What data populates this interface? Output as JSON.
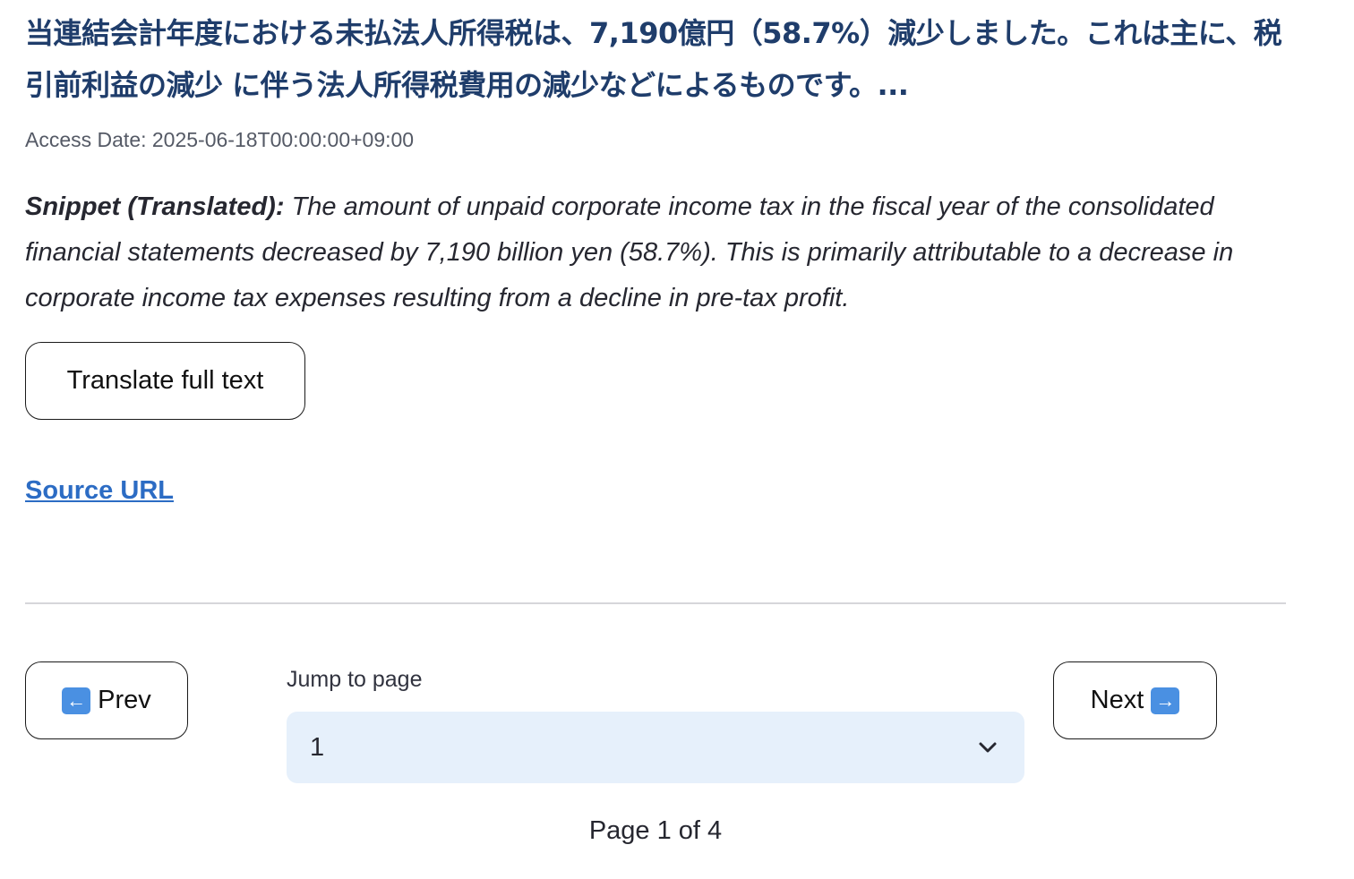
{
  "result": {
    "title": "当連結会計年度における未払法人所得税は、7,190億円（58.7%）減少しました。これは主に、税引前利益の減少 に伴う法人所得税費用の減少などによるものです。...",
    "access_date": "Access Date: 2025-06-18T00:00:00+09:00",
    "snippet_label": "Snippet (Translated):",
    "snippet_text": "The amount of unpaid corporate income tax in the fiscal year of the consolidated financial statements decreased by 7,190 billion yen (58.7%). This is primarily attributable to a decrease in corporate income tax expenses resulting from a decline in pre-tax profit.",
    "translate_button": "Translate full text",
    "source_link": "Source URL"
  },
  "pagination": {
    "prev_label": "Prev",
    "prev_icon": "left-arrow-icon",
    "next_label": "Next",
    "next_icon": "right-arrow-icon",
    "jump_label": "Jump to page",
    "selected_page": "1",
    "page_indicator": "Page 1 of 4"
  },
  "colors": {
    "title": "#1f3d6b",
    "link": "#2c6cc4",
    "select_bg": "#e6f0fb",
    "arrow_icon_bg": "#4a90e2"
  }
}
